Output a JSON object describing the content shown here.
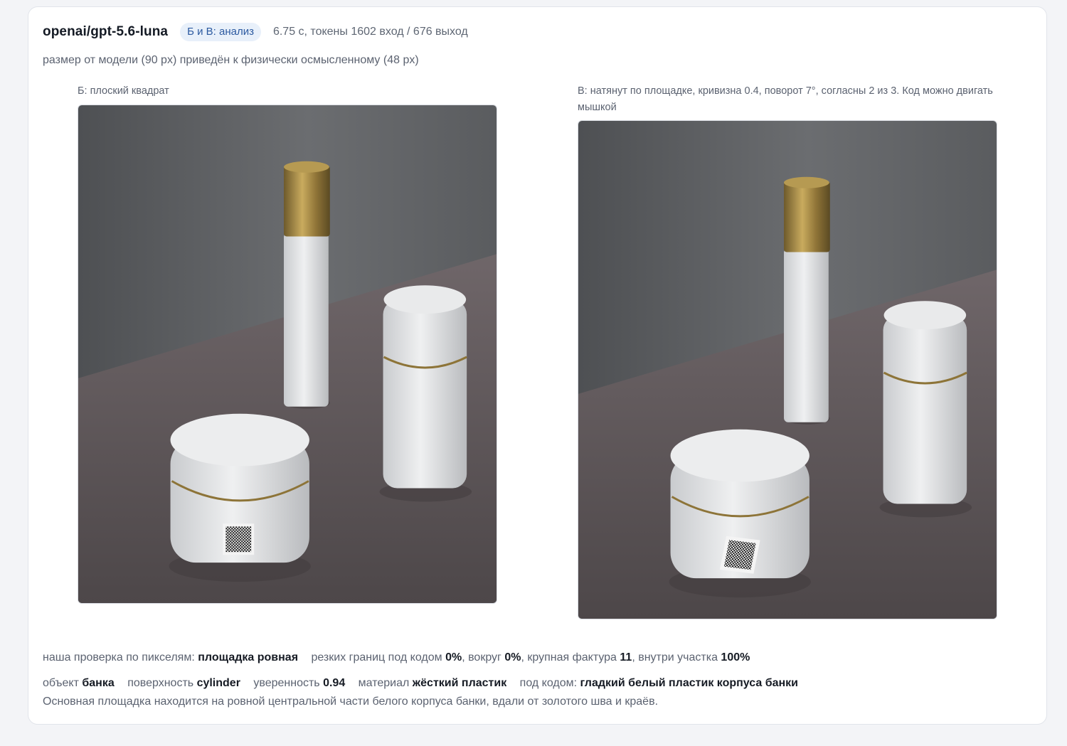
{
  "header": {
    "model": "openai/gpt-5.6-luna",
    "badge": "Б и В: анализ",
    "meta": "6.75 с, токены 1602 вход / 676 выход"
  },
  "note": "размер от модели (90 px) приведён к физически осмысленному (48 px)",
  "panels": {
    "left": {
      "caption": "Б: плоский квадрат"
    },
    "right": {
      "caption": "В: натянут по площадке, кривизна 0.4, поворот 7°, согласны 2 из 3. Код можно двигать мышкой"
    }
  },
  "stats": {
    "label": "наша проверка по пикселям:",
    "surface_verdict": "площадка ровная",
    "edges_label": "резких границ под кодом",
    "edges_value": "0%",
    "around_label": ", вокруг",
    "around_value": "0%",
    "texture_label": ", крупная фактура",
    "texture_value": "11",
    "inside_label": ", внутри участка",
    "inside_value": "100%"
  },
  "facts": {
    "object_label": "объект",
    "object_value": "банка",
    "surface_label": "поверхность",
    "surface_value": "cylinder",
    "confidence_label": "уверенность",
    "confidence_value": "0.94",
    "material_label": "материал",
    "material_value": "жёсткий пластик",
    "under_label": "под кодом:",
    "under_value": "гладкий белый пластик корпуса банки"
  },
  "description": "Основная площадка находится на ровной центральной части белого корпуса банки, вдали от золотого шва и краёв.",
  "colors": {
    "badge_bg": "#e8f0fa",
    "badge_text": "#2c5aa0",
    "wall": "#5a5c5f",
    "table": "#6d6568",
    "gold_cap": "#a88b46"
  }
}
